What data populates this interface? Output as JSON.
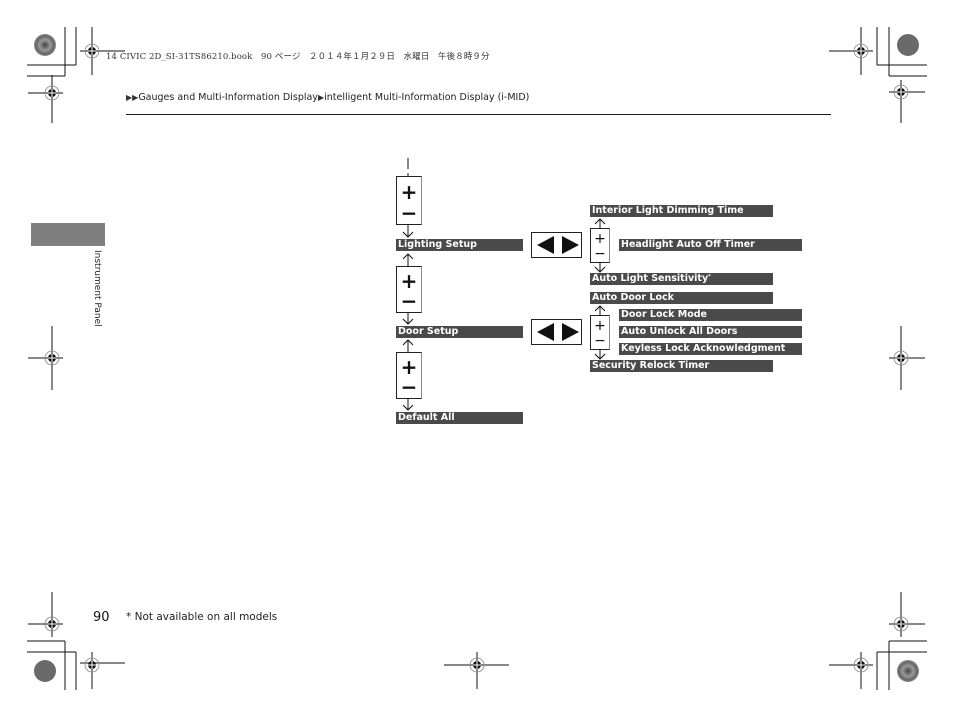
{
  "print_header": "14 CIVIC 2D_SI-31TS86210.book　90 ページ　２０１４年１月２９日　水曜日　午後８時９分",
  "breadcrumb": {
    "marker1": "▶▶",
    "item1": "Gauges and Multi-Information Display",
    "marker2": "▶",
    "item2": "intelligent Multi-Information Display (i-MID)"
  },
  "section_tab_label": "Instrument Panel",
  "page_number": "90",
  "footnote": "* Not available on all models",
  "diagram": {
    "main_menu": [
      {
        "label": "Lighting Setup"
      },
      {
        "label": "Door Setup"
      },
      {
        "label": "Default All"
      }
    ],
    "stepper": {
      "plus": "+",
      "minus": "−"
    },
    "lighting_submenu": {
      "above": "Interior Light Dimming Time",
      "current": "Headlight Auto Off Timer",
      "below": "Auto Light Sensitivity",
      "below_footnote_mark": "*"
    },
    "door_submenu": {
      "above": "Auto Door Lock",
      "items": [
        "Door Lock Mode",
        "Auto Unlock All Doors",
        "Keyless Lock Acknowledgment"
      ],
      "below": "Security Relock Timer"
    },
    "nav_icons": [
      "left-arrow",
      "right-arrow"
    ]
  }
}
